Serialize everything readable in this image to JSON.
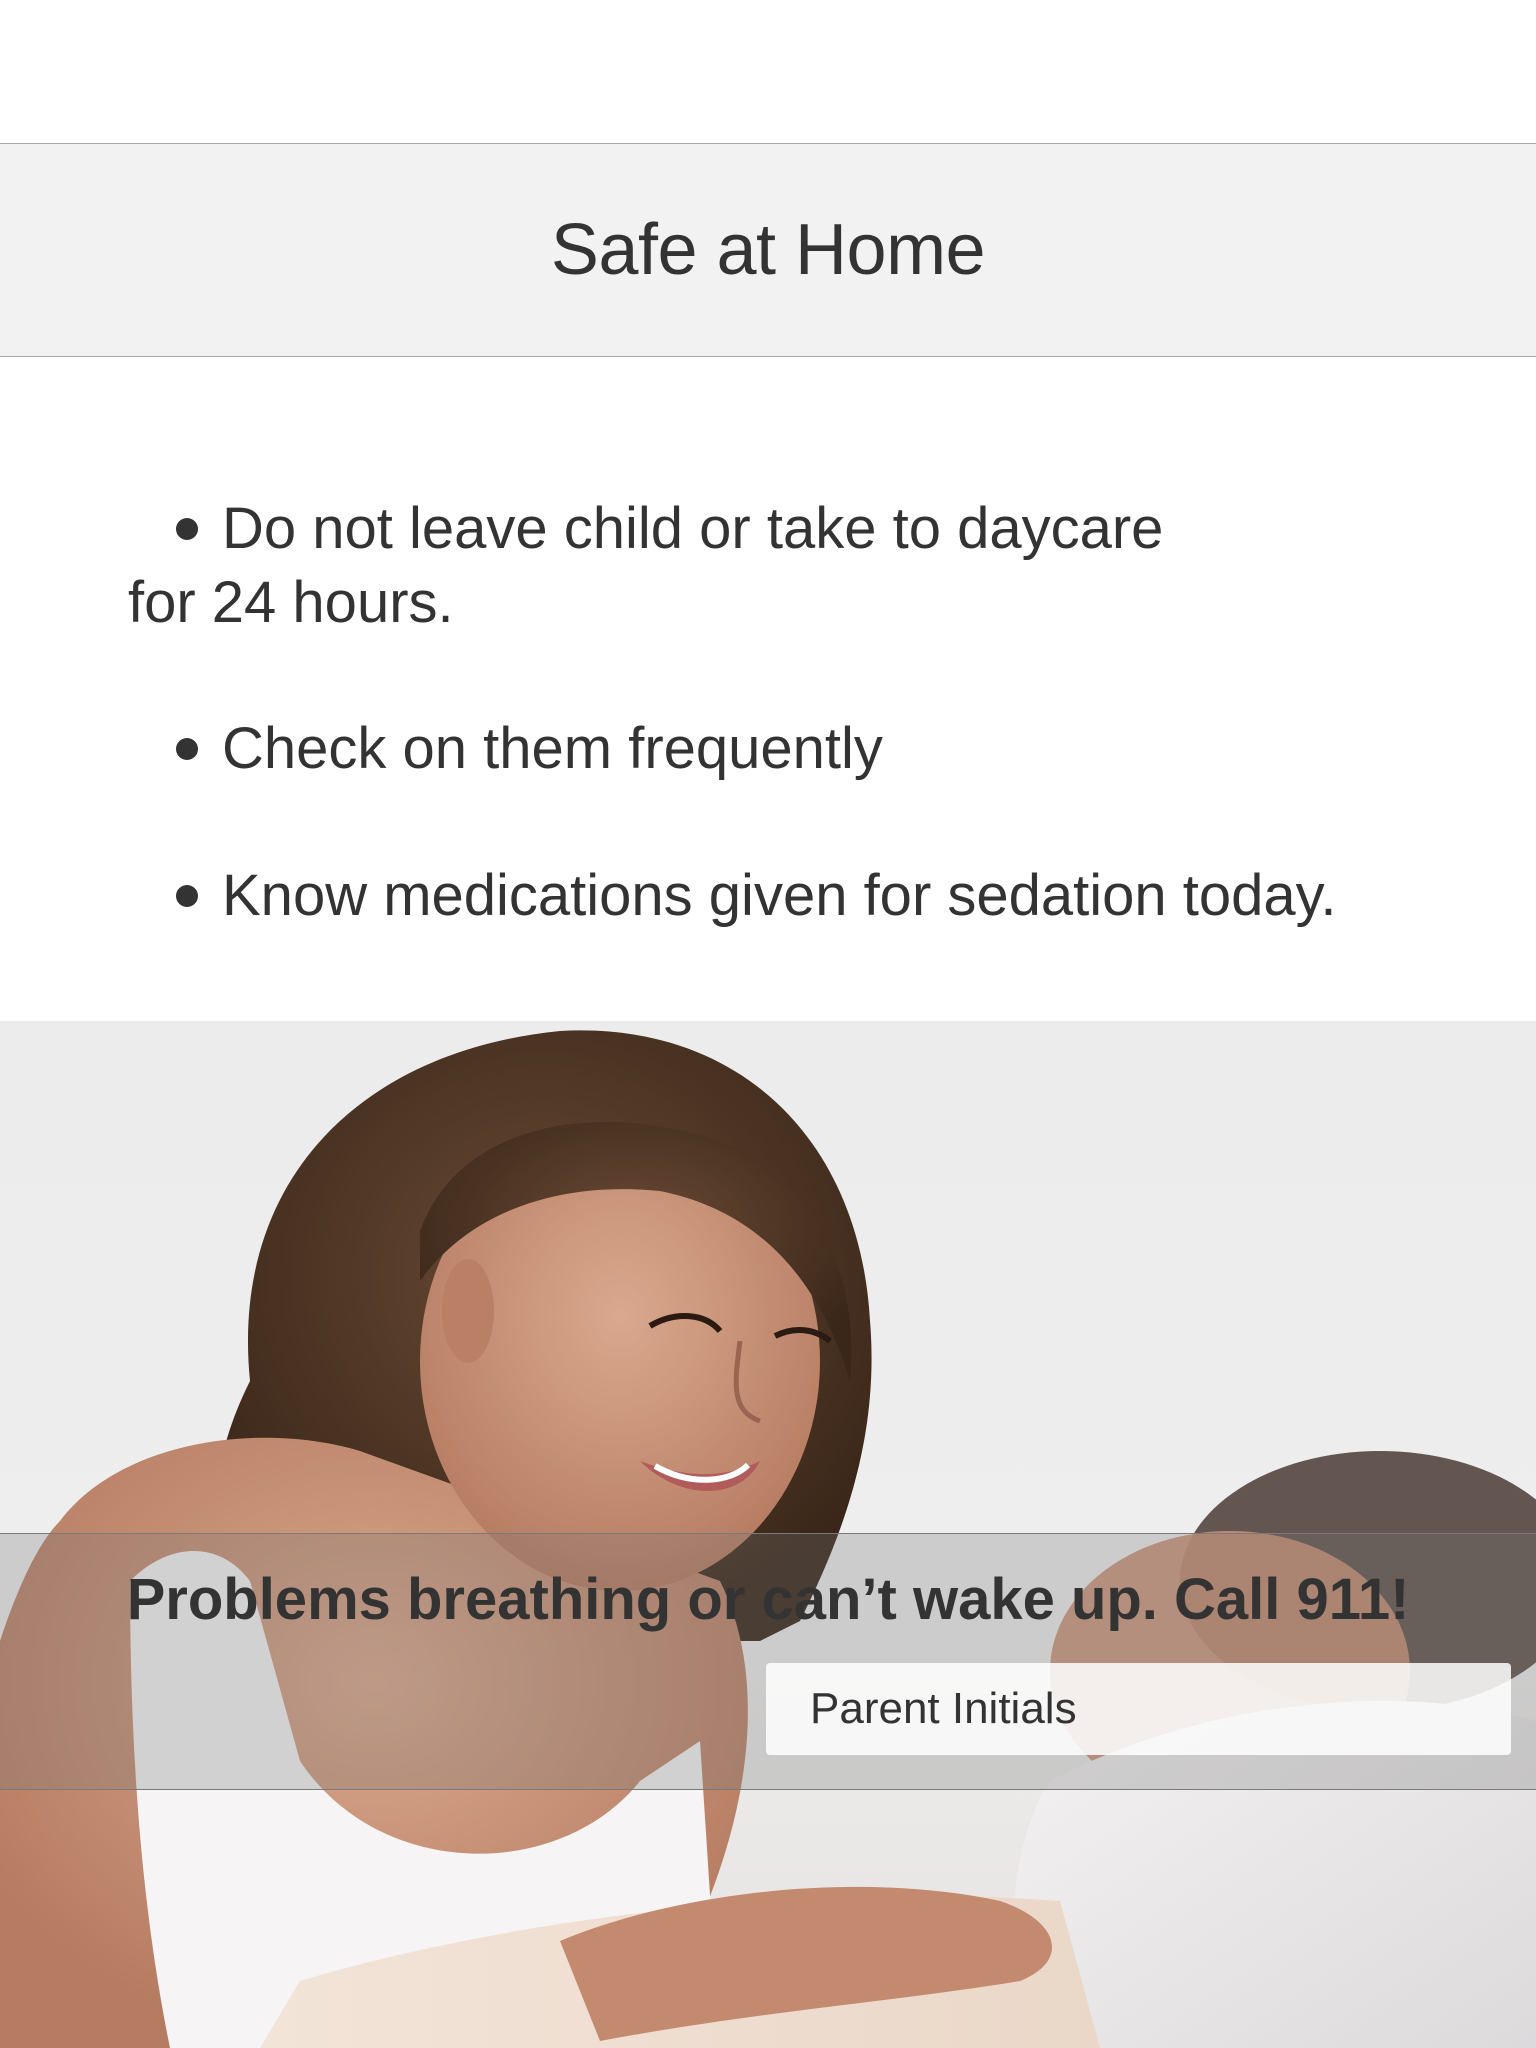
{
  "header": {
    "title": "Safe at Home"
  },
  "instructions": [
    {
      "line1": "Do not leave child or take to daycare",
      "line2": "for 24 hours."
    },
    {
      "line1": "Check on them frequently"
    },
    {
      "line1": "Know medications given for sedation today."
    }
  ],
  "alert": {
    "text": "Problems breathing or can’t wake up. Call 911!"
  },
  "initials": {
    "placeholder": "Parent Initials",
    "value": ""
  },
  "photo": {
    "icon": "mother-and-child-photo"
  },
  "colors": {
    "title_bar_bg": "#f2f2f2",
    "text": "#333333",
    "divider": "#a8a8a8"
  }
}
